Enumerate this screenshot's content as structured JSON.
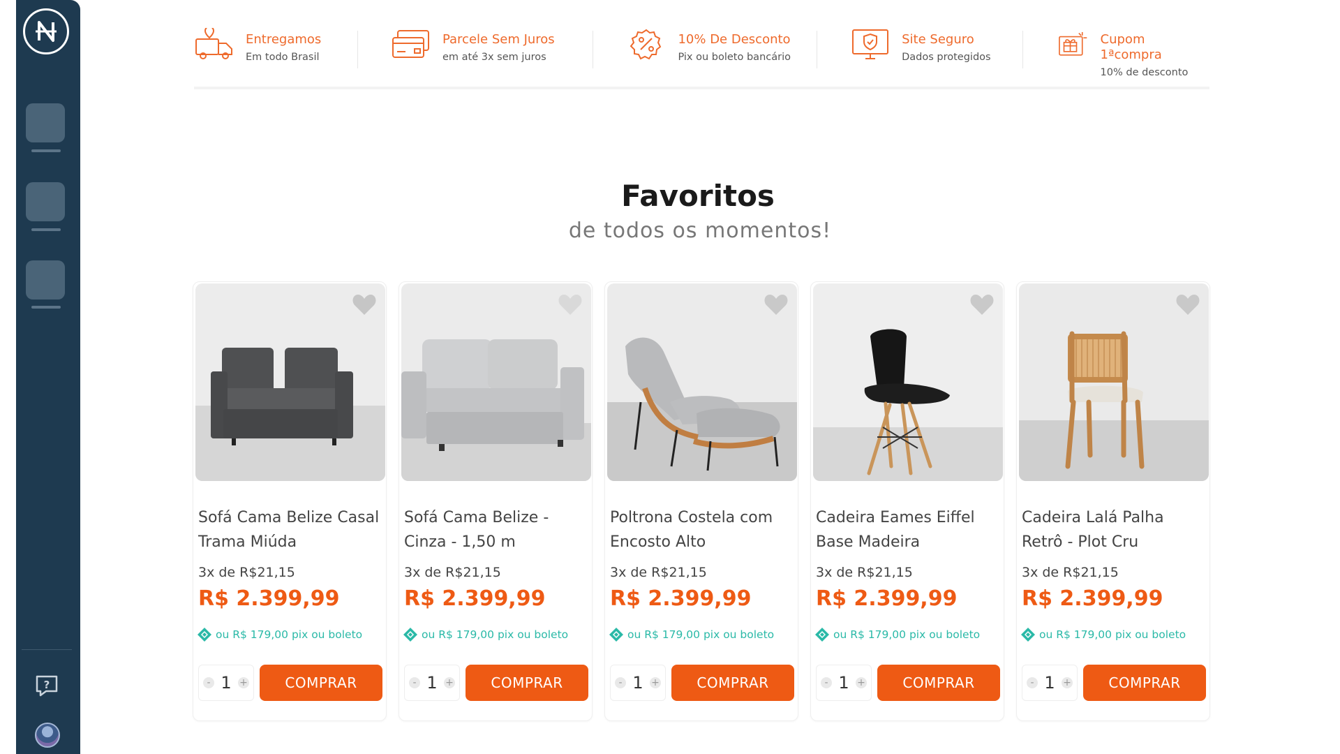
{
  "benefits": [
    {
      "title": "Entregamos",
      "subtitle": "Em todo Brasil",
      "icon": "delivery-truck-icon"
    },
    {
      "title": "Parcele Sem Juros",
      "subtitle": "em até 3x sem juros",
      "icon": "credit-card-icon"
    },
    {
      "title": "10% De Desconto",
      "subtitle": "Pix ou boleto bancário",
      "icon": "percent-badge-icon"
    },
    {
      "title": "Site Seguro",
      "subtitle": "Dados protegidos",
      "icon": "secure-monitor-icon"
    },
    {
      "title": "Cupom 1ªcompra",
      "subtitle": "10% de desconto",
      "icon": "gift-coupon-icon"
    }
  ],
  "section": {
    "title": "Favoritos",
    "subtitle": "de todos os momentos!"
  },
  "products": [
    {
      "name": "Sofá Cama Belize Casal Trama Miúda",
      "installments": "3x de R$21,15",
      "price": "R$ 2.399,99",
      "pix": "ou R$ 179,00 pix ou boleto",
      "qty": "1",
      "buy_label": "COMPRAR",
      "minus": "-",
      "plus": "+"
    },
    {
      "name": "Sofá Cama Belize - Cinza - 1,50 m",
      "installments": "3x de R$21,15",
      "price": "R$ 2.399,99",
      "pix": "ou R$ 179,00 pix ou boleto",
      "qty": "1",
      "buy_label": "COMPRAR",
      "minus": "-",
      "plus": "+"
    },
    {
      "name": "Poltrona Costela com Encosto Alto",
      "installments": "3x de R$21,15",
      "price": "R$ 2.399,99",
      "pix": "ou R$ 179,00 pix ou boleto",
      "qty": "1",
      "buy_label": "COMPRAR",
      "minus": "-",
      "plus": "+"
    },
    {
      "name": "Cadeira Eames Eiffel Base Madeira",
      "installments": "3x de R$21,15",
      "price": "R$ 2.399,99",
      "pix": "ou R$ 179,00 pix ou boleto",
      "qty": "1",
      "buy_label": "COMPRAR",
      "minus": "-",
      "plus": "+"
    },
    {
      "name": "Cadeira Lalá Palha Retrô - Plot Cru",
      "installments": "3x de R$21,15",
      "price": "R$ 2.399,99",
      "pix": "ou R$ 179,00 pix ou boleto",
      "qty": "1",
      "buy_label": "COMPRAR",
      "minus": "-",
      "plus": "+"
    }
  ],
  "colors": {
    "accent": "#ee5a14",
    "benefit_text": "#ee6a2c",
    "pix": "#2ab9a7",
    "sidebar": "#1e3a50"
  }
}
